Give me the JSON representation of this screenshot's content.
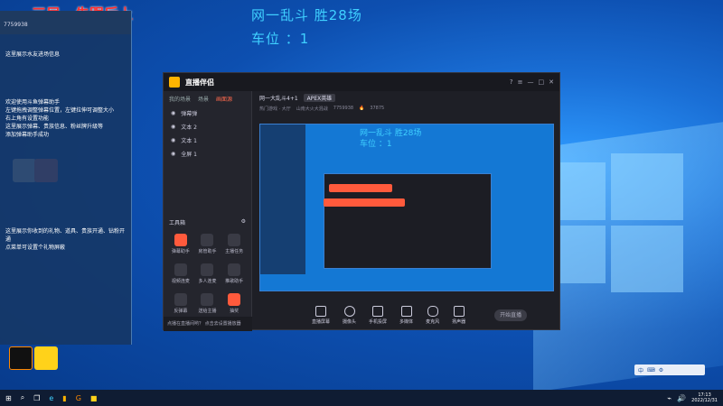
{
  "overlay": {
    "title": "网一乱斗 胜28场",
    "subtitle": "车位 ：1",
    "banner": "三局，先跟后上"
  },
  "left_panel": {
    "room_id": "7759938",
    "lines_top": [
      "这里展示水友进场信息"
    ],
    "lines_mid": [
      "欢迎使用斗鱼弹幕助手",
      "左键拖拽调整弹幕位置，左键拉伸可调整大小",
      "右上角有设置功能",
      "这里展示弹幕、贵族信息、粉丝牌升级等",
      "添加弹幕助手成功"
    ],
    "lines_bottom": [
      "这里展示你收到的礼物、道具、贵族开通、钻粉开通",
      "点菜单可设置个礼物屏蔽"
    ]
  },
  "app": {
    "name": "直播伴侣",
    "sidebar_tabs": [
      "我的场景",
      "场景",
      "画面源"
    ],
    "layers": [
      "弹幕弹",
      "文本 2",
      "文本 1",
      "全屏 1"
    ],
    "tools_title": "工具箱",
    "tools": [
      "弹幕助手",
      "房管助手",
      "主播任务",
      "视频连麦",
      "多人连麦",
      "推歌助手",
      "反弹幕",
      "送给主播",
      "抽奖"
    ],
    "hint": "点播在直播间哟？ 点击去设置播放器",
    "stream_title": "网一大乱斗4+1",
    "stream_tag": "APEX英雄",
    "meta": [
      "热门游戏 · 大厅",
      "山南大火大混战",
      "7759938",
      "37875"
    ],
    "preview_title": "网一乱斗 胜28场",
    "preview_sub": "车位 ：1",
    "controls": [
      "直播屏幕",
      "摄像头",
      "手机投屏",
      "多媒体",
      "麦克风",
      "扬声器"
    ],
    "start_label": "开始直播"
  },
  "taskbar": {
    "time": "17:13",
    "date": "2022/12/31",
    "ime": "中"
  }
}
